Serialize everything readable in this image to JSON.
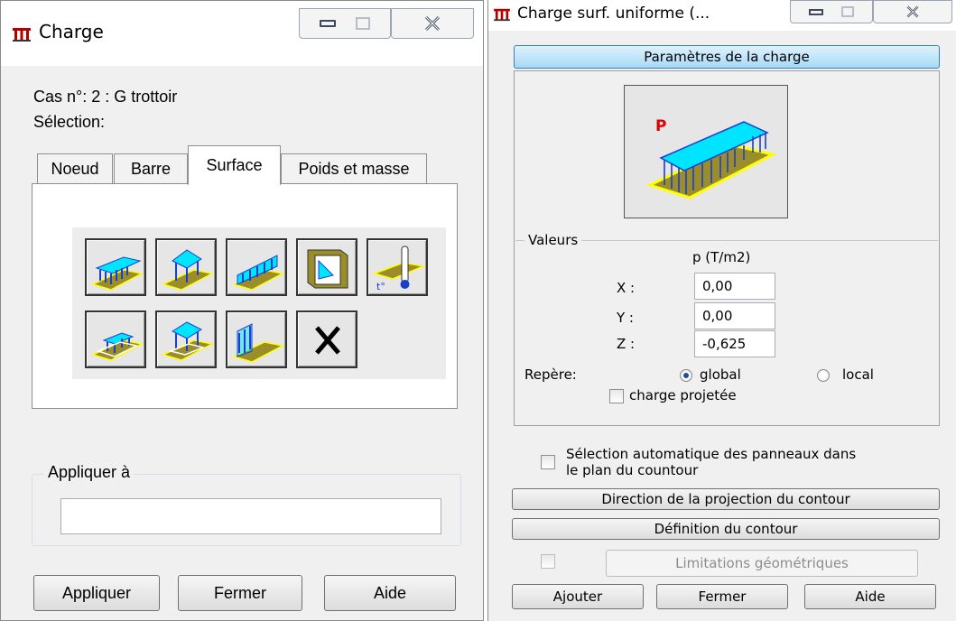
{
  "left_window": {
    "title": "Charge",
    "case_label": "Cas n°: 2 : G trottoir",
    "selection_label": "Sélection:",
    "tabs": [
      {
        "label": "Noeud",
        "active": false
      },
      {
        "label": "Barre",
        "active": false
      },
      {
        "label": "Surface",
        "active": true
      },
      {
        "label": "Poids et masse",
        "active": false
      }
    ],
    "load_tools": [
      {
        "icon": "uniform-surface-load-icon"
      },
      {
        "icon": "point-surface-load-icon"
      },
      {
        "icon": "linear-surface-load-icon"
      },
      {
        "icon": "hydrostatic-load-icon"
      },
      {
        "icon": "thermal-load-icon"
      },
      {
        "icon": "contour-uniform-load-icon"
      },
      {
        "icon": "contour-point-load-icon"
      },
      {
        "icon": "edge-line-load-icon"
      },
      {
        "icon": "delete-load-icon"
      }
    ],
    "apply_to_label": "Appliquer à",
    "apply_to_value": "",
    "buttons": {
      "apply": "Appliquer",
      "close": "Fermer",
      "help": "Aide"
    }
  },
  "right_window": {
    "title": "Charge surf. uniforme (...",
    "params_button": "Paramètres de la charge",
    "preview_label": "P",
    "values_group": "Valeurs",
    "column_header": "p    (T/m2)",
    "fields": [
      {
        "label": "X :",
        "value": "0,00"
      },
      {
        "label": "Y :",
        "value": "0,00"
      },
      {
        "label": "Z :",
        "value": "-0,625"
      }
    ],
    "repere_label": "Repère:",
    "radio_global": "global",
    "radio_local": "local",
    "radio_selected": "global",
    "projected_label": "charge projetée",
    "auto_select_label_1": "Sélection automatique des panneaux dans",
    "auto_select_label_2": "le plan du countour",
    "projection_direction_button": "Direction de la projection du contour",
    "contour_definition_button": "Définition du contour",
    "geometric_limits_button": "Limitations géométriques",
    "buttons": {
      "add": "Ajouter",
      "close": "Fermer",
      "help": "Aide"
    }
  },
  "colors": {
    "load_surface": "#00e5ff",
    "load_arrows": "#1a3fcf",
    "ground_plate": "#9a8d2a",
    "ground_edge": "#ffff00",
    "accent_blue": "#a7d9f5",
    "preview_label": "#e00000"
  }
}
